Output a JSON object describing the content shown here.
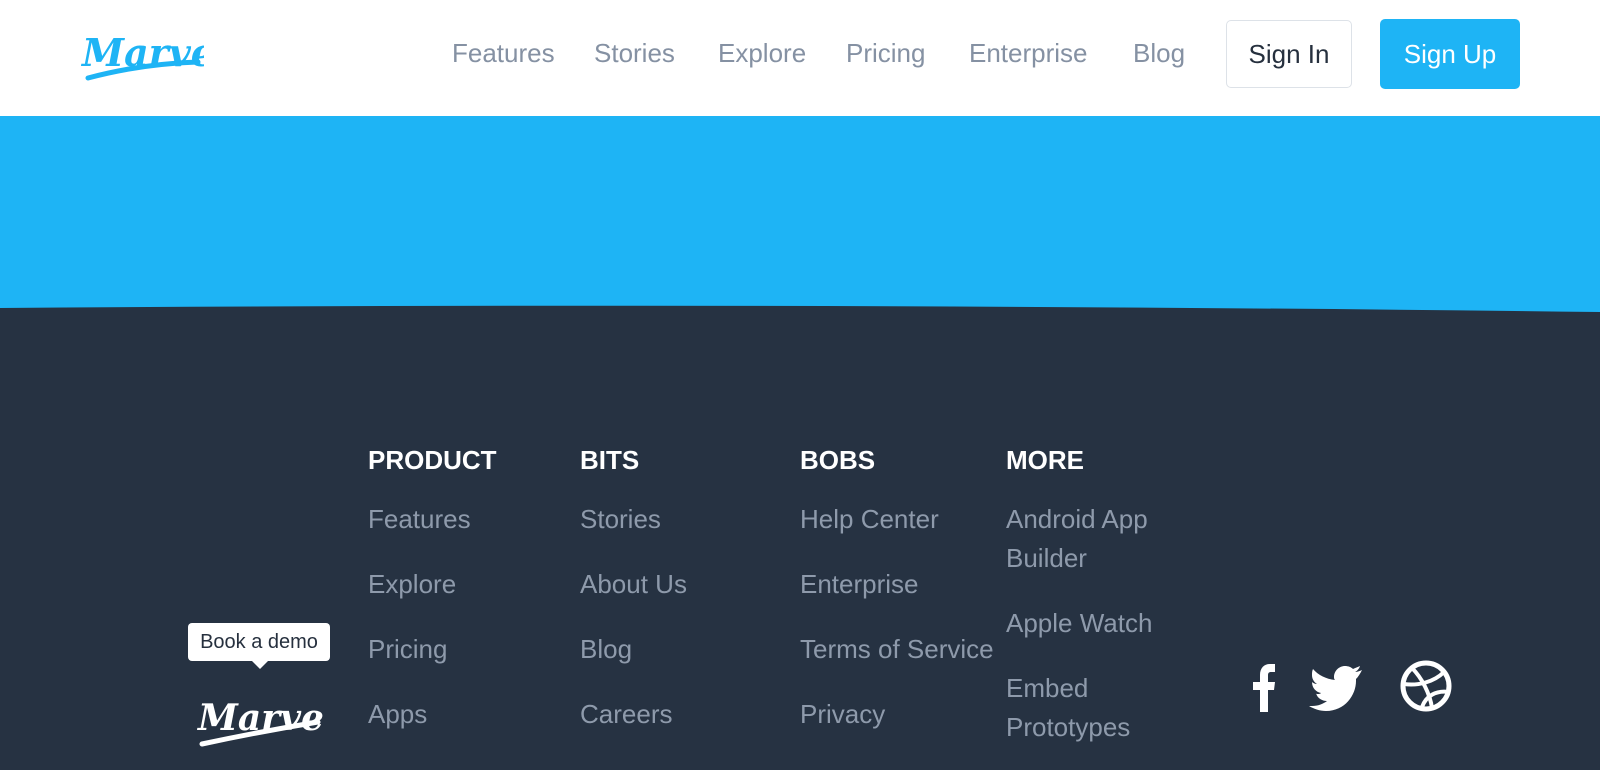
{
  "header": {
    "logo_text": "Marvel",
    "nav": [
      "Features",
      "Stories",
      "Explore",
      "Pricing",
      "Enterprise",
      "Blog"
    ],
    "signin_label": "Sign In",
    "signup_label": "Sign Up"
  },
  "footer": {
    "columns": [
      {
        "heading": "PRODUCT",
        "links": [
          "Features",
          "Explore",
          "Pricing",
          "Apps"
        ]
      },
      {
        "heading": "BITS",
        "links": [
          "Stories",
          "About Us",
          "Blog",
          "Careers"
        ]
      },
      {
        "heading": "BOBS",
        "links": [
          "Help Center",
          "Enterprise",
          "Terms of Service",
          "Privacy"
        ]
      },
      {
        "heading": "MORE",
        "links": [
          "Android App Builder",
          "Apple Watch",
          "Embed Prototypes"
        ]
      }
    ],
    "demo_label": "Book a demo",
    "logo_text": "Marvel",
    "social_icons": [
      "facebook-icon",
      "twitter-icon",
      "dribbble-icon"
    ]
  },
  "colors": {
    "brand": "#1eb4f5",
    "footer_bg": "#263242",
    "nav_text": "#8591a3",
    "footer_link": "#8e9aab"
  }
}
